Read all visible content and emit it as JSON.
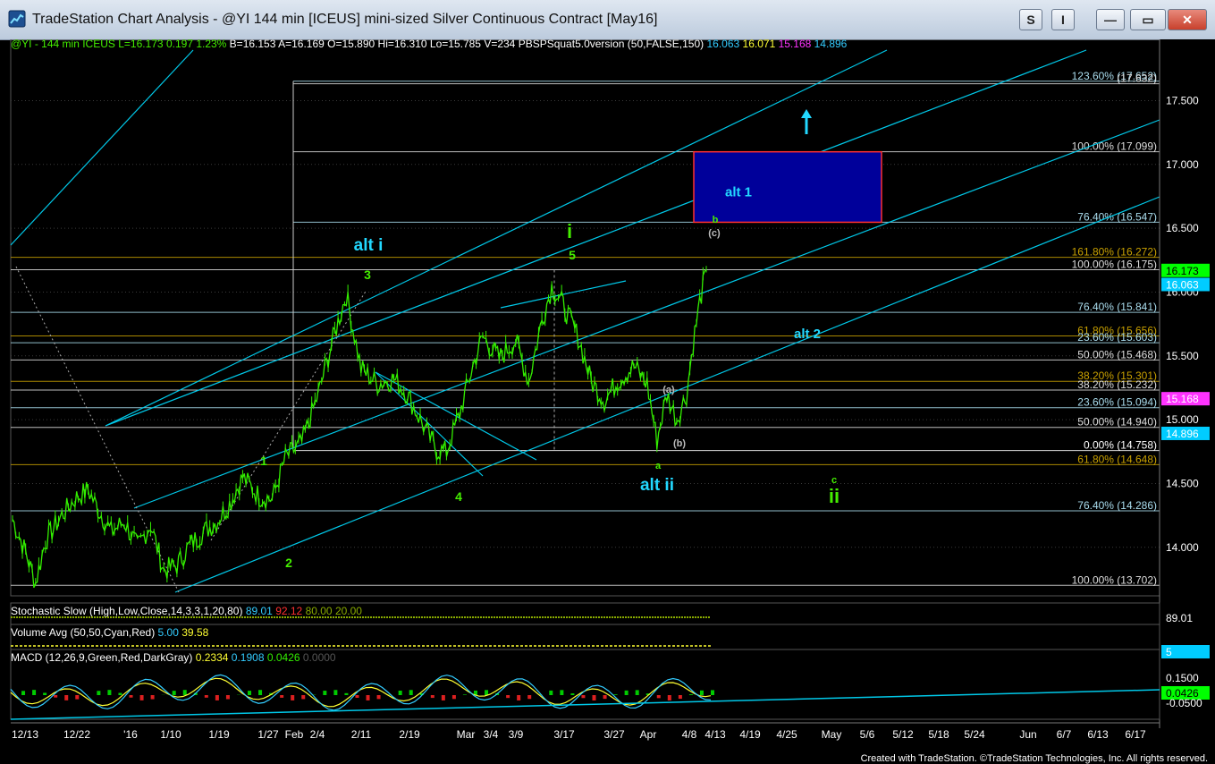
{
  "window": {
    "app": "TradeStation Chart Analysis",
    "title": "TradeStation Chart Analysis - @YI 144 min [ICEUS] mini-sized Silver Continuous Contract [May16]",
    "buttons": {
      "s": "S",
      "i": "I",
      "minimize": "—",
      "maximize": "▭",
      "close": "✕"
    }
  },
  "header": {
    "symbol": "@YI - 144 min ICEUS",
    "last": "L=16.173",
    "change": "0.197",
    "change_pct": "1.23%",
    "bid": "B=16.153",
    "ask": "A=16.169",
    "open": "O=15.890",
    "high": "Hi=16.310",
    "low": "Lo=15.785",
    "volume": "V=234",
    "study": "PBSPSquat5.0version (50,FALSE,150)",
    "study_values": [
      {
        "text": "16.063",
        "color": "#33ccff"
      },
      {
        "text": "16.071",
        "color": "#ffff33"
      },
      {
        "text": "15.168",
        "color": "#ff33ff"
      },
      {
        "text": "14.896",
        "color": "#33ccff"
      }
    ]
  },
  "colors": {
    "background": "#000000",
    "price": "#33ee00",
    "channel": "#00c8e8",
    "grid": "#3a3a3a",
    "fib_white": "#dddddd",
    "fib_gold": "#c8a000",
    "fib_cyan": "#00b8d8",
    "target_box": "#00009a",
    "target_border": "#ff3030",
    "wave_green": "#44ee00",
    "wave_cyan": "#22d8ff"
  },
  "price_axis": {
    "labels": [
      "17.500",
      "17.000",
      "16.500",
      "16.000",
      "15.500",
      "15.000",
      "14.500",
      "14.000"
    ],
    "tags": [
      {
        "text": "16.173",
        "value": 16.173,
        "bg": "#00ff00",
        "fg": "#000000"
      },
      {
        "text": "16.063",
        "value": 16.063,
        "bg": "#00ccff",
        "fg": "#ffffff"
      },
      {
        "text": "15.168",
        "value": 15.168,
        "bg": "#ff33ff",
        "fg": "#ffffff"
      },
      {
        "text": "14.896",
        "value": 14.896,
        "bg": "#00ccff",
        "fg": "#ffffff"
      }
    ]
  },
  "time_axis": {
    "labels": [
      "12/13",
      "12/22",
      "'16",
      "1/10",
      "1/19",
      "1/27",
      "Feb",
      "2/4",
      "2/11",
      "2/19",
      "Mar",
      "3/4",
      "3/9",
      "3/17",
      "3/27",
      "Apr",
      "4/8",
      "4/13",
      "4/19",
      "4/25",
      "May",
      "5/6",
      "5/12",
      "5/18",
      "5/24",
      "Jun",
      "6/7",
      "6/13",
      "6/17"
    ]
  },
  "fib_levels": [
    {
      "label": "123.60% (17.652)",
      "value": 17.652,
      "color": "#aaddee"
    },
    {
      "label": "(17.632)",
      "value": 17.632,
      "color": "#dddddd"
    },
    {
      "label": "100.00% (17.099)",
      "value": 17.099,
      "color": "#dddddd"
    },
    {
      "label": "76.40% (16.547)",
      "value": 16.547,
      "color": "#aaddee"
    },
    {
      "label": "161.80% (16.272)",
      "value": 16.272,
      "color": "#c8a000"
    },
    {
      "label": "100.00% (16.175)",
      "value": 16.175,
      "color": "#dddddd"
    },
    {
      "label": "76.40% (15.841)",
      "value": 15.841,
      "color": "#aaddee"
    },
    {
      "label": "61.80% (15.656)",
      "value": 15.656,
      "color": "#c8a000"
    },
    {
      "label": "23.60% (15.603)",
      "value": 15.603,
      "color": "#aaddee"
    },
    {
      "label": "50.00% (15.468)",
      "value": 15.468,
      "color": "#dddddd"
    },
    {
      "label": "38.20% (15.301)",
      "value": 15.301,
      "color": "#c8a000"
    },
    {
      "label": "38.20% (15.232)",
      "value": 15.232,
      "color": "#dddddd"
    },
    {
      "label": "23.60% (15.094)",
      "value": 15.094,
      "color": "#aaddee"
    },
    {
      "label": "50.00% (14.940)",
      "value": 14.94,
      "color": "#dddddd"
    },
    {
      "label": "0.00% (14.758)",
      "value": 14.758,
      "color": "#ffffff"
    },
    {
      "label": "61.80% (14.648)",
      "value": 14.648,
      "color": "#c8a000"
    },
    {
      "label": "76.40% (14.286)",
      "value": 14.286,
      "color": "#aaddee"
    },
    {
      "label": "100.00% (13.702)",
      "value": 13.702,
      "color": "#dddddd"
    }
  ],
  "target_box": {
    "label": "alt 1",
    "top": 17.099,
    "bottom": 16.547
  },
  "wave_labels": [
    {
      "text": "alt i",
      "color": "#22d8ff",
      "size": 19
    },
    {
      "text": "3",
      "color": "#44ee00",
      "size": 14
    },
    {
      "text": "i",
      "color": "#44ee00",
      "size": 22
    },
    {
      "text": "5",
      "color": "#44ee00",
      "size": 14
    },
    {
      "text": "1",
      "color": "#44ee00",
      "size": 14
    },
    {
      "text": "2",
      "color": "#44ee00",
      "size": 14
    },
    {
      "text": "4",
      "color": "#44ee00",
      "size": 14
    },
    {
      "text": "alt ii",
      "color": "#22d8ff",
      "size": 19
    },
    {
      "text": "a",
      "color": "#44ee00",
      "size": 11
    },
    {
      "text": "(a)",
      "color": "#bbbbbb",
      "size": 11
    },
    {
      "text": "(b)",
      "color": "#bbbbbb",
      "size": 11
    },
    {
      "text": "b",
      "color": "#44ee00",
      "size": 11
    },
    {
      "text": "(c)",
      "color": "#bbbbbb",
      "size": 11
    },
    {
      "text": "alt 2",
      "color": "#22d8ff",
      "size": 15
    },
    {
      "text": "c",
      "color": "#44ee00",
      "size": 11
    },
    {
      "text": "ii",
      "color": "#44ee00",
      "size": 22
    }
  ],
  "indicators": {
    "stochastic": {
      "label": "Stochastic Slow (High,Low,Close,14,3,3,1,20,80)",
      "values": [
        {
          "text": "89.01",
          "color": "#33ccff"
        },
        {
          "text": "92.12",
          "color": "#ff3030"
        },
        {
          "text": "80.00",
          "color": "#88aa00"
        },
        {
          "text": "20.00",
          "color": "#88aa00"
        }
      ],
      "tag": "89.01"
    },
    "volume": {
      "label": "Volume Avg (50,50,Cyan,Red)",
      "values": [
        {
          "text": "5.00",
          "color": "#33ccff"
        },
        {
          "text": "39.58",
          "color": "#ffff33"
        }
      ],
      "tag": "5"
    },
    "macd": {
      "label": "MACD (12,26,9,Green,Red,DarkGray)",
      "values": [
        {
          "text": "0.2334",
          "color": "#ffff33"
        },
        {
          "text": "0.1908",
          "color": "#33ccff"
        },
        {
          "text": "0.0426",
          "color": "#33ee00"
        },
        {
          "text": "0.0000",
          "color": "#555555"
        }
      ],
      "axis": [
        "0.1500",
        "0.0426",
        "-0.0500"
      ],
      "tag": "0.0426"
    }
  },
  "chart_data": {
    "type": "line",
    "ylim": [
      13.62,
      17.98
    ],
    "x_count": 330,
    "note_anchors": "closes",
    "anchors": [
      [
        0,
        14.22
      ],
      [
        8,
        13.96
      ],
      [
        14,
        13.72
      ],
      [
        20,
        14.05
      ],
      [
        30,
        14.25
      ],
      [
        38,
        14.38
      ],
      [
        46,
        14.45
      ],
      [
        52,
        14.3
      ],
      [
        60,
        14.12
      ],
      [
        68,
        14.2
      ],
      [
        76,
        14.0
      ],
      [
        84,
        14.18
      ],
      [
        92,
        13.82
      ],
      [
        100,
        13.86
      ],
      [
        108,
        14.02
      ],
      [
        116,
        14.12
      ],
      [
        124,
        14.2
      ],
      [
        132,
        14.34
      ],
      [
        140,
        14.55
      ],
      [
        150,
        14.4
      ],
      [
        158,
        14.38
      ],
      [
        166,
        14.7
      ],
      [
        176,
        14.82
      ],
      [
        186,
        15.2
      ],
      [
        196,
        15.68
      ],
      [
        203,
        15.98
      ],
      [
        212,
        15.4
      ],
      [
        222,
        15.28
      ],
      [
        232,
        15.32
      ],
      [
        240,
        15.2
      ],
      [
        250,
        14.95
      ],
      [
        258,
        14.76
      ],
      [
        264,
        14.75
      ],
      [
        272,
        15.05
      ],
      [
        280,
        15.42
      ],
      [
        286,
        15.65
      ],
      [
        296,
        15.48
      ],
      [
        306,
        15.62
      ],
      [
        314,
        15.3
      ],
      [
        322,
        15.78
      ],
      [
        328,
        16.04
      ],
      [
        334,
        15.92
      ],
      [
        344,
        15.65
      ],
      [
        352,
        15.3
      ],
      [
        360,
        15.15
      ],
      [
        368,
        15.3
      ],
      [
        378,
        15.42
      ],
      [
        386,
        15.28
      ],
      [
        392,
        14.84
      ],
      [
        398,
        15.2
      ],
      [
        404,
        15.0
      ],
      [
        410,
        15.2
      ],
      [
        414,
        15.6
      ],
      [
        418,
        15.92
      ],
      [
        422,
        16.173
      ]
    ],
    "x_max_index": 422,
    "y_ticks": [
      14.0,
      14.5,
      15.0,
      15.5,
      16.0,
      16.5,
      17.0,
      17.5
    ]
  },
  "footer": {
    "credit": "Created with TradeStation. ©TradeStation Technologies, Inc. All rights reserved."
  }
}
